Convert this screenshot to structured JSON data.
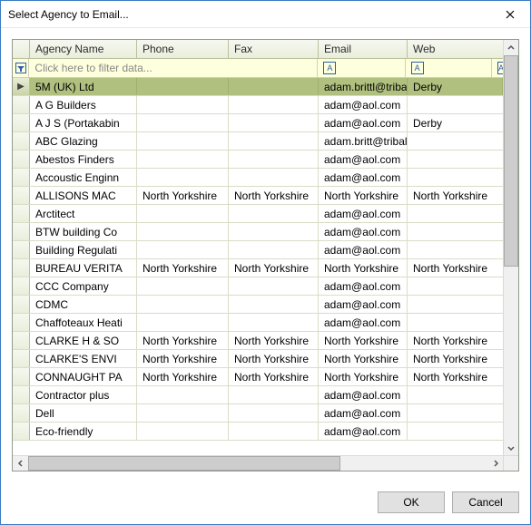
{
  "window": {
    "title": "Select Agency to Email...",
    "close_icon_name": "close-icon"
  },
  "grid": {
    "columns": [
      "Agency Name",
      "Phone",
      "Fax",
      "Email",
      "Web"
    ],
    "filter_placeholder": "Click here to filter data...",
    "filter_glyph": "A",
    "filter_indicator_glyph": "▨",
    "selected_row_glyph": "▶",
    "rows": [
      {
        "selected": true,
        "name": "5M (UK) Ltd",
        "phone": "",
        "fax": "",
        "email": "adam.brittl@tribal",
        "web": "Derby"
      },
      {
        "selected": false,
        "name": "A G Builders",
        "phone": "",
        "fax": "",
        "email": "adam@aol.com",
        "web": ""
      },
      {
        "selected": false,
        "name": "A J S (Portakabin",
        "phone": "",
        "fax": "",
        "email": "adam@aol.com",
        "web": "Derby"
      },
      {
        "selected": false,
        "name": "ABC Glazing",
        "phone": "",
        "fax": "",
        "email": "adam.britt@tribal",
        "web": ""
      },
      {
        "selected": false,
        "name": "Abestos Finders",
        "phone": "",
        "fax": "",
        "email": "adam@aol.com",
        "web": ""
      },
      {
        "selected": false,
        "name": "Accoustic Enginn",
        "phone": "",
        "fax": "",
        "email": "adam@aol.com",
        "web": ""
      },
      {
        "selected": false,
        "name": "ALLISONS MAC",
        "phone": "North Yorkshire",
        "fax": "North Yorkshire",
        "email": "North Yorkshire",
        "web": "North Yorkshire"
      },
      {
        "selected": false,
        "name": "Arctitect",
        "phone": "",
        "fax": "",
        "email": "adam@aol.com",
        "web": ""
      },
      {
        "selected": false,
        "name": "BTW building Co",
        "phone": "",
        "fax": "",
        "email": "adam@aol.com",
        "web": ""
      },
      {
        "selected": false,
        "name": "Building Regulati",
        "phone": "",
        "fax": "",
        "email": "adam@aol.com",
        "web": ""
      },
      {
        "selected": false,
        "name": "BUREAU VERITA",
        "phone": "North Yorkshire",
        "fax": "North Yorkshire",
        "email": "North Yorkshire",
        "web": "North Yorkshire"
      },
      {
        "selected": false,
        "name": "CCC Company",
        "phone": "",
        "fax": "",
        "email": "adam@aol.com",
        "web": ""
      },
      {
        "selected": false,
        "name": "CDMC",
        "phone": "",
        "fax": "",
        "email": "adam@aol.com",
        "web": ""
      },
      {
        "selected": false,
        "name": "Chaffoteaux Heati",
        "phone": "",
        "fax": "",
        "email": "adam@aol.com",
        "web": ""
      },
      {
        "selected": false,
        "name": "CLARKE H & SO",
        "phone": "North Yorkshire",
        "fax": "North Yorkshire",
        "email": "North Yorkshire",
        "web": "North Yorkshire"
      },
      {
        "selected": false,
        "name": "CLARKE'S ENVI",
        "phone": "North Yorkshire",
        "fax": "North Yorkshire",
        "email": "North Yorkshire",
        "web": "North Yorkshire"
      },
      {
        "selected": false,
        "name": "CONNAUGHT PA",
        "phone": "North Yorkshire",
        "fax": "North Yorkshire",
        "email": "North Yorkshire",
        "web": "North Yorkshire"
      },
      {
        "selected": false,
        "name": "Contractor plus",
        "phone": "",
        "fax": "",
        "email": "adam@aol.com",
        "web": ""
      },
      {
        "selected": false,
        "name": "Dell",
        "phone": "",
        "fax": "",
        "email": "adam@aol.com",
        "web": ""
      },
      {
        "selected": false,
        "name": "Eco-friendly",
        "phone": "",
        "fax": "",
        "email": "adam@aol.com",
        "web": ""
      }
    ]
  },
  "buttons": {
    "ok": "OK",
    "cancel": "Cancel"
  }
}
